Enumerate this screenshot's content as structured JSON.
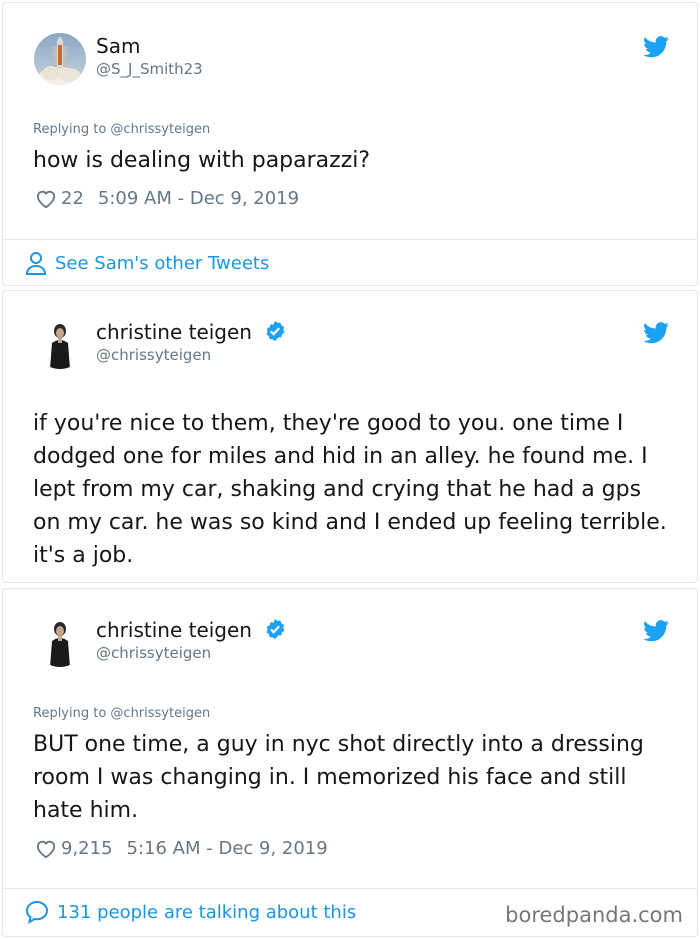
{
  "tweets": [
    {
      "name": "Sam",
      "handle": "@S_J_Smith23",
      "verified": false,
      "replying_to": "Replying to @chrissyteigen",
      "text": "how is dealing with paparazzi?",
      "likes": "22",
      "timestamp": "5:09 AM - Dec 9, 2019",
      "footer_link": "See Sam's other Tweets"
    },
    {
      "name": "christine teigen",
      "handle": "@chrissyteigen",
      "verified": true,
      "text": "if you're nice to them, they're good to you. one time I dodged one for miles and hid in an alley. he found me. I lept from my car, shaking and crying that he had a gps on my car. he was so kind and I ended up feeling terrible. it's a job."
    },
    {
      "name": "christine teigen",
      "handle": "@chrissyteigen",
      "verified": true,
      "replying_to": "Replying to @chrissyteigen",
      "text": "BUT one time, a guy in nyc shot directly into a dressing room I was changing in. I memorized his face and still hate him.",
      "likes": "9,215",
      "timestamp": "5:16 AM - Dec 9, 2019",
      "footer_link": "131 people are talking about this"
    }
  ],
  "watermark": "boredpanda.com",
  "colors": {
    "twitter_blue": "#1da1f2",
    "link_blue": "#1b95e0",
    "muted_gray": "#657786",
    "border": "#e1e8ed"
  },
  "icons": [
    "twitter-bird-icon",
    "verified-badge-icon",
    "heart-icon",
    "person-icon",
    "speech-bubble-icon"
  ]
}
